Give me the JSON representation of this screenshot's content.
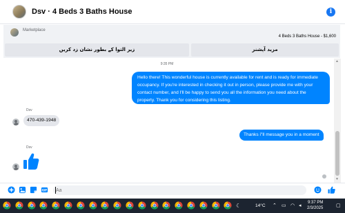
{
  "header": {
    "title": "Dsv · 4 Beds 3 Baths House",
    "info_icon": "i"
  },
  "banner": {
    "source_label": "Marketplace",
    "listing_text": "4 Beds 3 Baths House - $1,600",
    "button_left": "زیر التوا کے بطور نشان زد کریں",
    "button_right": "مزید آپشنز"
  },
  "chat": {
    "timestamp": "9:35 PM",
    "messages": [
      {
        "direction": "outgoing",
        "text": "Hello there! This wonderful house is currently available for rent and is ready for immediate occupancy. If you're interested in checking it out in person, please provide me with your contact number, and I'll be happy to send you all the information you need about the property. Thank you for considering this listing."
      },
      {
        "direction": "incoming",
        "sender": "Dsv",
        "text": "470-439-1948"
      },
      {
        "direction": "outgoing",
        "text": "Thanks i''ll message you in a moment"
      },
      {
        "direction": "incoming",
        "sender": "Dsv",
        "sticker": "like-thumb-icon"
      }
    ]
  },
  "composer": {
    "placeholder": "Aa",
    "icons": [
      "plus-circle-icon",
      "image-icon",
      "sticker-icon",
      "gif-icon",
      "emoji-icon",
      "like-icon"
    ]
  },
  "taskbar": {
    "apps": [
      "chrome-icon",
      "chrome-icon",
      "chrome-icon",
      "chrome-icon",
      "chrome-icon",
      "chrome-icon",
      "chrome-icon",
      "chrome-icon",
      "chrome-icon",
      "chrome-icon",
      "chrome-icon",
      "chrome-icon",
      "chrome-icon",
      "chrome-icon",
      "chrome-icon",
      "chrome-icon",
      "chrome-icon",
      "chrome-icon",
      "chrome-icon"
    ],
    "temperature": "14°C",
    "time": "9:37 PM",
    "date": "2/3/2025"
  },
  "colors": {
    "accent": "#0084ff",
    "incoming_bubble": "#e4e6eb",
    "taskbar": "#1c2430"
  }
}
